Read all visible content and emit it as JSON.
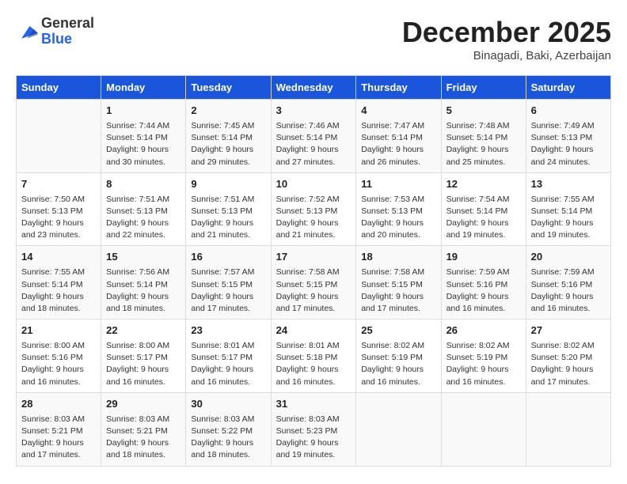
{
  "logo": {
    "general": "General",
    "blue": "Blue"
  },
  "header": {
    "month": "December 2025",
    "location": "Binagadi, Baki, Azerbaijan"
  },
  "days_of_week": [
    "Sunday",
    "Monday",
    "Tuesday",
    "Wednesday",
    "Thursday",
    "Friday",
    "Saturday"
  ],
  "weeks": [
    [
      {
        "day": "",
        "info": ""
      },
      {
        "day": "1",
        "info": "Sunrise: 7:44 AM\nSunset: 5:14 PM\nDaylight: 9 hours\nand 30 minutes."
      },
      {
        "day": "2",
        "info": "Sunrise: 7:45 AM\nSunset: 5:14 PM\nDaylight: 9 hours\nand 29 minutes."
      },
      {
        "day": "3",
        "info": "Sunrise: 7:46 AM\nSunset: 5:14 PM\nDaylight: 9 hours\nand 27 minutes."
      },
      {
        "day": "4",
        "info": "Sunrise: 7:47 AM\nSunset: 5:14 PM\nDaylight: 9 hours\nand 26 minutes."
      },
      {
        "day": "5",
        "info": "Sunrise: 7:48 AM\nSunset: 5:14 PM\nDaylight: 9 hours\nand 25 minutes."
      },
      {
        "day": "6",
        "info": "Sunrise: 7:49 AM\nSunset: 5:13 PM\nDaylight: 9 hours\nand 24 minutes."
      }
    ],
    [
      {
        "day": "7",
        "info": "Sunrise: 7:50 AM\nSunset: 5:13 PM\nDaylight: 9 hours\nand 23 minutes."
      },
      {
        "day": "8",
        "info": "Sunrise: 7:51 AM\nSunset: 5:13 PM\nDaylight: 9 hours\nand 22 minutes."
      },
      {
        "day": "9",
        "info": "Sunrise: 7:51 AM\nSunset: 5:13 PM\nDaylight: 9 hours\nand 21 minutes."
      },
      {
        "day": "10",
        "info": "Sunrise: 7:52 AM\nSunset: 5:13 PM\nDaylight: 9 hours\nand 21 minutes."
      },
      {
        "day": "11",
        "info": "Sunrise: 7:53 AM\nSunset: 5:13 PM\nDaylight: 9 hours\nand 20 minutes."
      },
      {
        "day": "12",
        "info": "Sunrise: 7:54 AM\nSunset: 5:14 PM\nDaylight: 9 hours\nand 19 minutes."
      },
      {
        "day": "13",
        "info": "Sunrise: 7:55 AM\nSunset: 5:14 PM\nDaylight: 9 hours\nand 19 minutes."
      }
    ],
    [
      {
        "day": "14",
        "info": "Sunrise: 7:55 AM\nSunset: 5:14 PM\nDaylight: 9 hours\nand 18 minutes."
      },
      {
        "day": "15",
        "info": "Sunrise: 7:56 AM\nSunset: 5:14 PM\nDaylight: 9 hours\nand 18 minutes."
      },
      {
        "day": "16",
        "info": "Sunrise: 7:57 AM\nSunset: 5:15 PM\nDaylight: 9 hours\nand 17 minutes."
      },
      {
        "day": "17",
        "info": "Sunrise: 7:58 AM\nSunset: 5:15 PM\nDaylight: 9 hours\nand 17 minutes."
      },
      {
        "day": "18",
        "info": "Sunrise: 7:58 AM\nSunset: 5:15 PM\nDaylight: 9 hours\nand 17 minutes."
      },
      {
        "day": "19",
        "info": "Sunrise: 7:59 AM\nSunset: 5:16 PM\nDaylight: 9 hours\nand 16 minutes."
      },
      {
        "day": "20",
        "info": "Sunrise: 7:59 AM\nSunset: 5:16 PM\nDaylight: 9 hours\nand 16 minutes."
      }
    ],
    [
      {
        "day": "21",
        "info": "Sunrise: 8:00 AM\nSunset: 5:16 PM\nDaylight: 9 hours\nand 16 minutes."
      },
      {
        "day": "22",
        "info": "Sunrise: 8:00 AM\nSunset: 5:17 PM\nDaylight: 9 hours\nand 16 minutes."
      },
      {
        "day": "23",
        "info": "Sunrise: 8:01 AM\nSunset: 5:17 PM\nDaylight: 9 hours\nand 16 minutes."
      },
      {
        "day": "24",
        "info": "Sunrise: 8:01 AM\nSunset: 5:18 PM\nDaylight: 9 hours\nand 16 minutes."
      },
      {
        "day": "25",
        "info": "Sunrise: 8:02 AM\nSunset: 5:19 PM\nDaylight: 9 hours\nand 16 minutes."
      },
      {
        "day": "26",
        "info": "Sunrise: 8:02 AM\nSunset: 5:19 PM\nDaylight: 9 hours\nand 16 minutes."
      },
      {
        "day": "27",
        "info": "Sunrise: 8:02 AM\nSunset: 5:20 PM\nDaylight: 9 hours\nand 17 minutes."
      }
    ],
    [
      {
        "day": "28",
        "info": "Sunrise: 8:03 AM\nSunset: 5:21 PM\nDaylight: 9 hours\nand 17 minutes."
      },
      {
        "day": "29",
        "info": "Sunrise: 8:03 AM\nSunset: 5:21 PM\nDaylight: 9 hours\nand 18 minutes."
      },
      {
        "day": "30",
        "info": "Sunrise: 8:03 AM\nSunset: 5:22 PM\nDaylight: 9 hours\nand 18 minutes."
      },
      {
        "day": "31",
        "info": "Sunrise: 8:03 AM\nSunset: 5:23 PM\nDaylight: 9 hours\nand 19 minutes."
      },
      {
        "day": "",
        "info": ""
      },
      {
        "day": "",
        "info": ""
      },
      {
        "day": "",
        "info": ""
      }
    ]
  ]
}
